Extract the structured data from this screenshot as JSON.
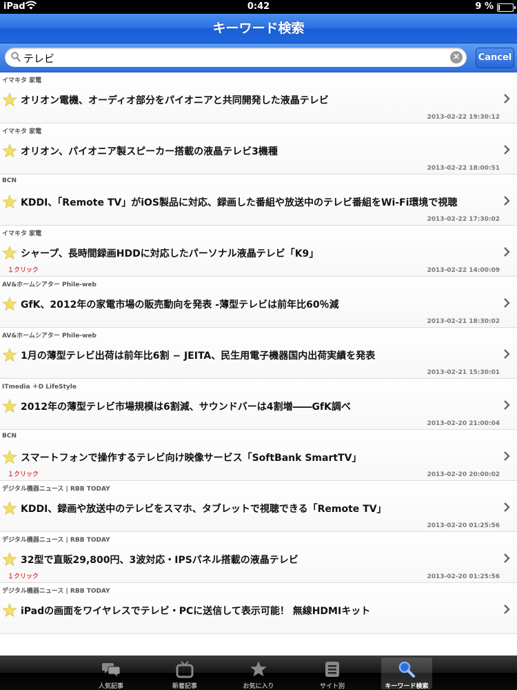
{
  "status": {
    "carrier": "iPad",
    "time": "0:42",
    "battery": "9 %",
    "battery_level": 0.09
  },
  "nav": {
    "title": "キーワード検索"
  },
  "search": {
    "value": "テレビ",
    "cancel_label": "Cancel"
  },
  "articles": [
    {
      "source": "イマキタ 家電",
      "headline": "オリオン電機、オーディオ部分をパイオニアと共同開発した液晶テレビ",
      "clicks": "",
      "date": "2013-02-22 19:30:12"
    },
    {
      "source": "イマキタ 家電",
      "headline": "オリオン、パイオニア製スピーカー搭載の液晶テレビ3機種",
      "clicks": "",
      "date": "2013-02-22 18:00:51"
    },
    {
      "source": "BCN",
      "headline": "KDDI、「Remote TV」がiOS製品に対応、録画した番組や放送中のテレビ番組をWi-Fi環境で視聴",
      "clicks": "",
      "date": "2013-02-22 17:30:02"
    },
    {
      "source": "イマキタ 家電",
      "headline": "シャープ、長時間録画HDDに対応したパーソナル液晶テレビ「K9」",
      "clicks": "１クリック",
      "date": "2013-02-22 14:00:09"
    },
    {
      "source": "AV&ホームシアター Phile-web",
      "headline": "GfK、2012年の家電市場の販売動向を発表 -薄型テレビは前年比60％減",
      "clicks": "",
      "date": "2013-02-21 18:30:02"
    },
    {
      "source": "AV&ホームシアター Phile-web",
      "headline": "1月の薄型テレビ出荷は前年比6割 − JEITA、民生用電子機器国内出荷実績を発表",
      "clicks": "",
      "date": "2013-02-21 15:30:01"
    },
    {
      "source": "ITmedia ＋D LifeStyle",
      "headline": "2012年の薄型テレビ市場規模は6割減、サウンドバーは4割増――GfK調べ",
      "clicks": "",
      "date": "2013-02-20 21:00:04"
    },
    {
      "source": "BCN",
      "headline": "スマートフォンで操作するテレビ向け映像サービス「SoftBank SmartTV」",
      "clicks": "１クリック",
      "date": "2013-02-20 20:00:02"
    },
    {
      "source": "デジタル機器ニュース | RBB TODAY",
      "headline": "KDDI、録画や放送中のテレビをスマホ、タブレットで視聴できる「Remote TV」",
      "clicks": "",
      "date": "2013-02-20 01:25:56"
    },
    {
      "source": "デジタル機器ニュース | RBB TODAY",
      "headline": "32型で直販29,800円、3波対応・IPSパネル搭載の液晶テレビ",
      "clicks": "１クリック",
      "date": "2013-02-20 01:25:56"
    },
    {
      "source": "デジタル機器ニュース | RBB TODAY",
      "headline": "iPadの画面をワイヤレスでテレビ・PCに送信して表示可能！ 無線HDMIキット",
      "clicks": "",
      "date": ""
    }
  ],
  "tabs": [
    {
      "label": "人気記事",
      "icon": "speech-bubbles-icon",
      "active": false
    },
    {
      "label": "新着記事",
      "icon": "tv-icon",
      "active": false
    },
    {
      "label": "お気に入り",
      "icon": "star-icon",
      "active": false
    },
    {
      "label": "サイト別",
      "icon": "list-icon",
      "active": false
    },
    {
      "label": "キーワード検索",
      "icon": "search-icon",
      "active": true
    }
  ],
  "colors": {
    "nav_blue": "#2a6fe0",
    "star": "#f2df6a",
    "click_red": "#e04040"
  }
}
